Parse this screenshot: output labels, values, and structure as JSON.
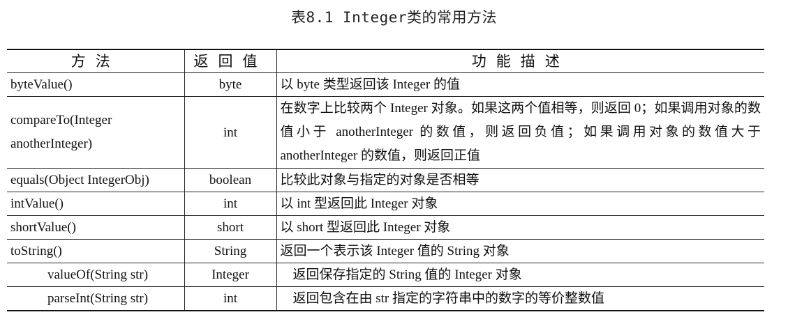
{
  "caption": "表8.1  Integer类的常用方法",
  "table": {
    "headers": {
      "method": "方法",
      "return_value": "返回值",
      "description": "功能描述"
    },
    "rows": [
      {
        "method": "byteValue()",
        "return_value": "byte",
        "description": "以 byte 类型返回该 Integer 的值"
      },
      {
        "method": "compareTo(Integer anotherInteger)",
        "return_value": "int",
        "description": "在数字上比较两个 Integer 对象。如果这两个值相等，则返回 0；如果调用对象的数值小于 anotherInteger 的数值，则返回负值；如果调用对象的数值大于 anotherInteger 的数值，则返回正值"
      },
      {
        "method": "equals(Object IntegerObj)",
        "return_value": "boolean",
        "description": "比较此对象与指定的对象是否相等"
      },
      {
        "method": "intValue()",
        "return_value": "int",
        "description": "以 int 型返回此 Integer 对象"
      },
      {
        "method": "shortValue()",
        "return_value": "short",
        "description": "以 short 型返回此 Integer 对象"
      },
      {
        "method": "toString()",
        "return_value": "String",
        "description": "返回一个表示该 Integer 值的 String 对象"
      },
      {
        "method": "valueOf(String str)",
        "return_value": "Integer",
        "description": "返回保存指定的 String 值的 Integer 对象"
      },
      {
        "method": "parseInt(String str)",
        "return_value": "int",
        "description": "返回包含在由 str 指定的字符串中的数字的等价整数值"
      }
    ]
  }
}
